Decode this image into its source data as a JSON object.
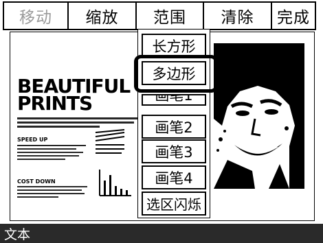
{
  "tabs": [
    {
      "label": "移动",
      "disabled": true
    },
    {
      "label": "缩放",
      "disabled": false
    },
    {
      "label": "范围",
      "disabled": false
    },
    {
      "label": "清除",
      "disabled": false
    },
    {
      "label": "完成",
      "disabled": false
    }
  ],
  "dropdown": {
    "items": [
      {
        "label": "长方形"
      },
      {
        "label": "多边形",
        "focused": true
      },
      {
        "label": "画笔1"
      },
      {
        "label": "画笔2"
      },
      {
        "label": "画笔3"
      },
      {
        "label": "画笔4"
      },
      {
        "label": "选区闪烁"
      }
    ]
  },
  "canvas": {
    "headline_line1": "BEAUTIFUL",
    "headline_line2": "PRINTS",
    "subhead1": "SPEED UP",
    "subhead2": "COST DOWN"
  },
  "status_bar": {
    "text": "文本"
  },
  "colors": {
    "status_bar_bg": "#2a2a2a",
    "disabled_text": "#9a9a9a",
    "border": "#000000"
  }
}
